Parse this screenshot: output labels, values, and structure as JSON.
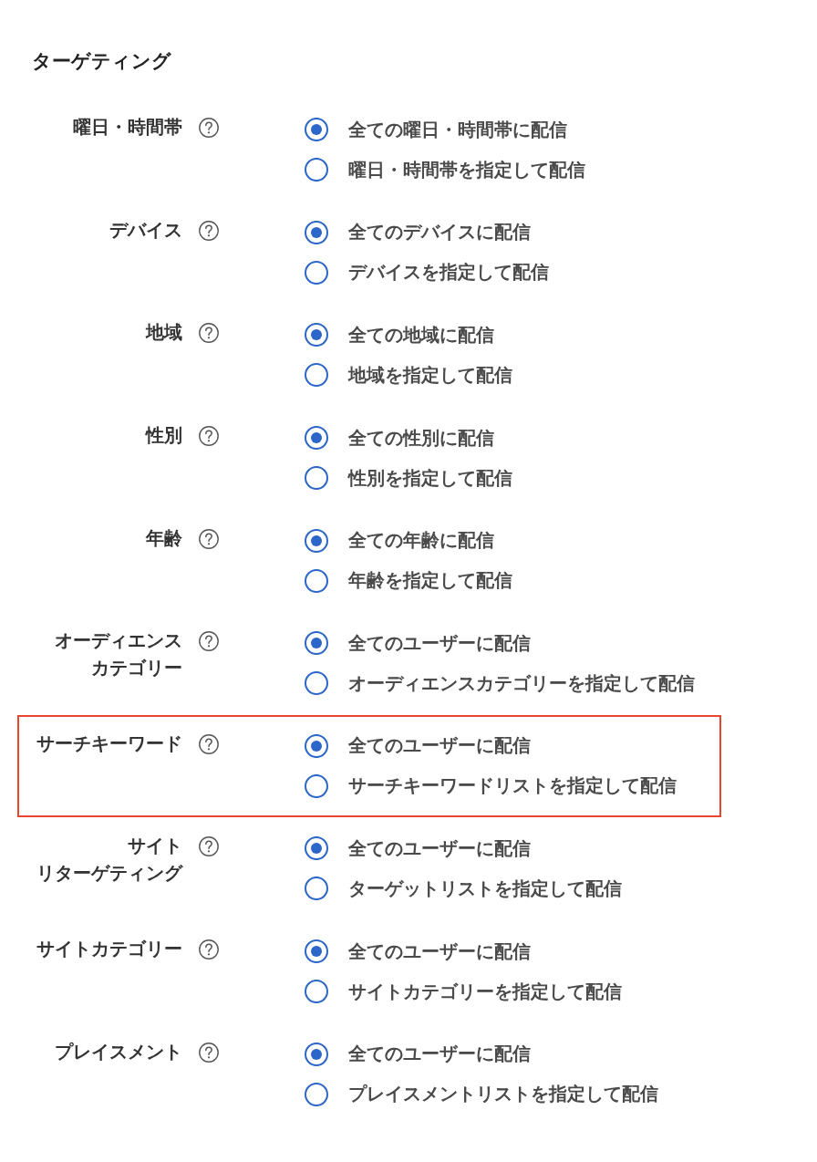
{
  "title": "ターゲティング",
  "groups": [
    {
      "label_lines": [
        "曜日・時間帯"
      ],
      "highlighted": false,
      "options": [
        {
          "label": "全ての曜日・時間帯に配信",
          "selected": true
        },
        {
          "label": "曜日・時間帯を指定して配信",
          "selected": false
        }
      ]
    },
    {
      "label_lines": [
        "デバイス"
      ],
      "highlighted": false,
      "options": [
        {
          "label": "全てのデバイスに配信",
          "selected": true
        },
        {
          "label": "デバイスを指定して配信",
          "selected": false
        }
      ]
    },
    {
      "label_lines": [
        "地域"
      ],
      "highlighted": false,
      "options": [
        {
          "label": "全ての地域に配信",
          "selected": true
        },
        {
          "label": "地域を指定して配信",
          "selected": false
        }
      ]
    },
    {
      "label_lines": [
        "性別"
      ],
      "highlighted": false,
      "options": [
        {
          "label": "全ての性別に配信",
          "selected": true
        },
        {
          "label": "性別を指定して配信",
          "selected": false
        }
      ]
    },
    {
      "label_lines": [
        "年齢"
      ],
      "highlighted": false,
      "options": [
        {
          "label": "全ての年齢に配信",
          "selected": true
        },
        {
          "label": "年齢を指定して配信",
          "selected": false
        }
      ]
    },
    {
      "label_lines": [
        "オーディエンス",
        "カテゴリー"
      ],
      "highlighted": false,
      "options": [
        {
          "label": "全てのユーザーに配信",
          "selected": true
        },
        {
          "label": "オーディエンスカテゴリーを指定して配信",
          "selected": false
        }
      ]
    },
    {
      "label_lines": [
        "サーチキーワード"
      ],
      "highlighted": true,
      "options": [
        {
          "label": "全てのユーザーに配信",
          "selected": true
        },
        {
          "label": "サーチキーワードリストを指定して配信",
          "selected": false
        }
      ]
    },
    {
      "label_lines": [
        "サイト",
        "リターゲティング"
      ],
      "highlighted": false,
      "options": [
        {
          "label": "全てのユーザーに配信",
          "selected": true
        },
        {
          "label": "ターゲットリストを指定して配信",
          "selected": false
        }
      ]
    },
    {
      "label_lines": [
        "サイトカテゴリー"
      ],
      "highlighted": false,
      "options": [
        {
          "label": "全てのユーザーに配信",
          "selected": true
        },
        {
          "label": "サイトカテゴリーを指定して配信",
          "selected": false
        }
      ]
    },
    {
      "label_lines": [
        "プレイスメント"
      ],
      "highlighted": false,
      "options": [
        {
          "label": "全てのユーザーに配信",
          "selected": true
        },
        {
          "label": "プレイスメントリストを指定して配信",
          "selected": false
        }
      ]
    }
  ]
}
